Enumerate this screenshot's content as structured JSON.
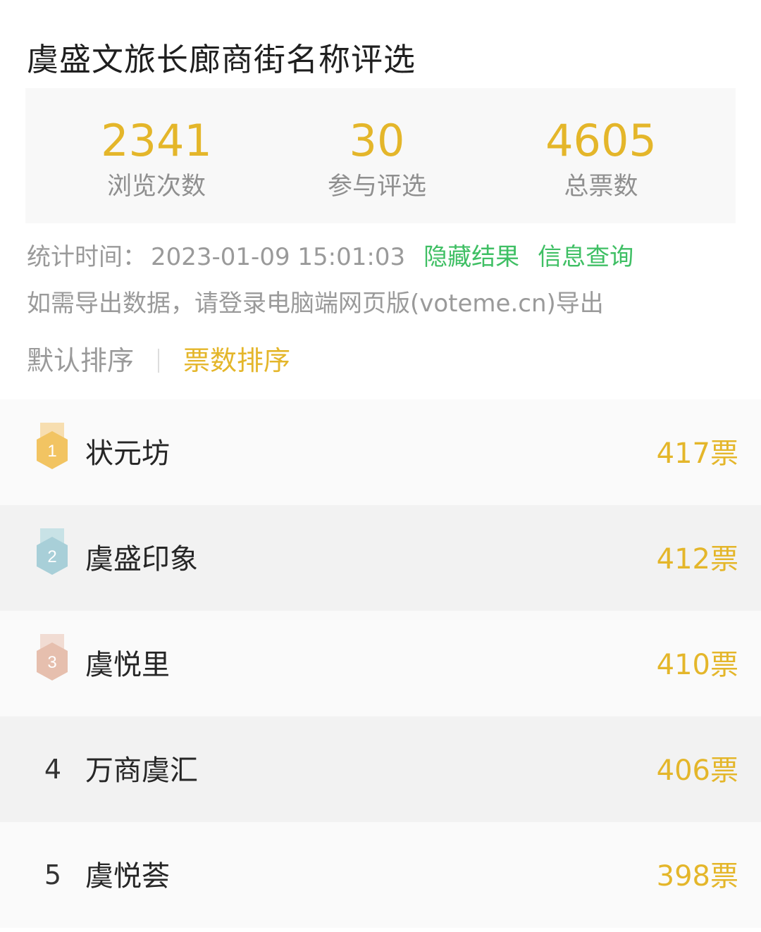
{
  "title": "虞盛文旅长廊商街名称评选",
  "stats": [
    {
      "value": "2341",
      "label": "浏览次数"
    },
    {
      "value": "30",
      "label": "参与评选"
    },
    {
      "value": "4605",
      "label": "总票数"
    }
  ],
  "meta": {
    "time_label": "统计时间：",
    "time_value": "2023-01-09 15:01:03",
    "hide_results": "隐藏结果",
    "info_query": "信息查询",
    "export_note": "如需导出数据，请登录电脑端网页版(voteme.cn)导出"
  },
  "sort": {
    "default_label": "默认排序",
    "votes_label": "票数排序",
    "active": "votes"
  },
  "ranking": [
    {
      "rank": "1",
      "name": "状元坊",
      "votes": "417票",
      "medal": "gold"
    },
    {
      "rank": "2",
      "name": "虞盛印象",
      "votes": "412票",
      "medal": "silver"
    },
    {
      "rank": "3",
      "name": "虞悦里",
      "votes": "410票",
      "medal": "bronze"
    },
    {
      "rank": "4",
      "name": "万商虞汇",
      "votes": "406票",
      "medal": ""
    },
    {
      "rank": "5",
      "name": "虞悦荟",
      "votes": "398票",
      "medal": ""
    }
  ],
  "colors": {
    "accent": "#e4b62a",
    "link_green": "#3fbf64",
    "gold_medal": "#f2c462",
    "gold_ribbon": "#f7deb0",
    "silver_medal": "#a8cfd8",
    "silver_ribbon": "#c8e2e6",
    "bronze_medal": "#e6bfae",
    "bronze_ribbon": "#f1dcd3"
  }
}
